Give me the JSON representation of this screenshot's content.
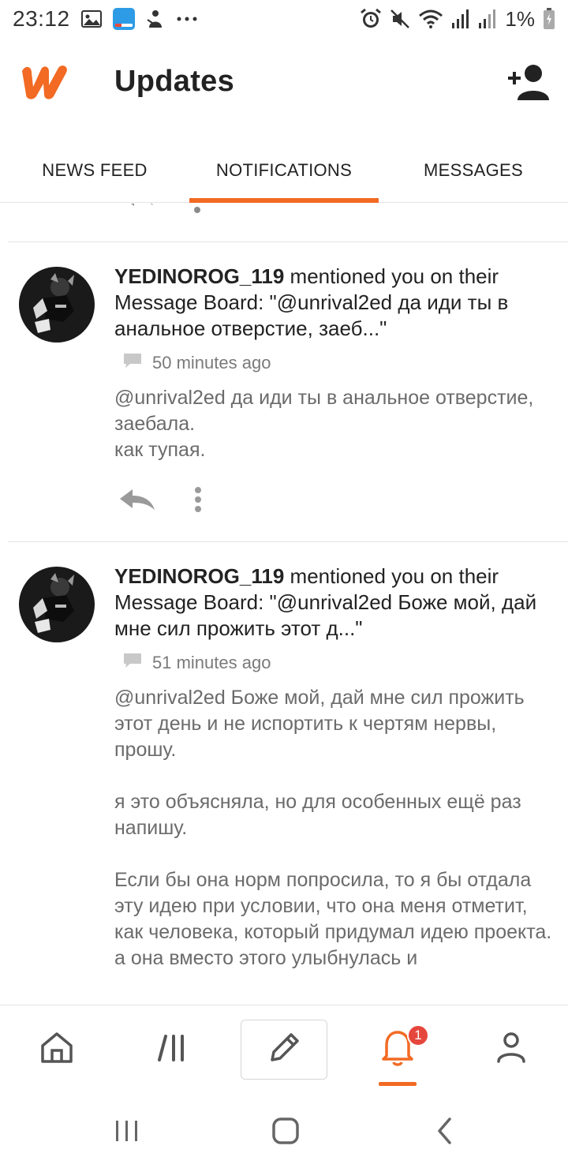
{
  "status_bar": {
    "time": "23:12",
    "battery_percent": "1%",
    "icons_left": [
      "image-icon",
      "wordbit-app-icon",
      "app-notification-icon",
      "more-dots-icon"
    ],
    "icons_right": [
      "alarm-icon",
      "mute-icon",
      "wifi-icon",
      "signal-icon",
      "signal-icon",
      "battery-charging-icon"
    ]
  },
  "header": {
    "title": "Updates",
    "logo_icon": "wattpad-logo",
    "add_friend_icon": "add-person-icon"
  },
  "tabs": [
    {
      "label": "NEWS FEED",
      "active": false
    },
    {
      "label": "NOTIFICATIONS",
      "active": true
    },
    {
      "label": "MESSAGES",
      "active": false
    }
  ],
  "notifications": [
    {
      "username": "YEDINOROG_119",
      "action_text": " mentioned you on their Message Board: \"@unrival2ed да иди ты в анальное отверстие, заеб...\"",
      "time": "50 minutes ago",
      "body": "@unrival2ed  да иди ты в анальное отверстие, заебала.\nкак тупая."
    },
    {
      "username": "YEDINOROG_119",
      "action_text": " mentioned you on their Message Board: \"@unrival2ed Боже мой, дай мне сил прожить этот д...\"",
      "time": "51 minutes ago",
      "body": "@unrival2ed  Боже мой, дай мне сил прожить этот день и не испортить к чертям нервы, прошу.\n\nя это объясняла, но для особенных ещё раз напишу.\n\nЕсли бы она норм попросила, то я бы отдала эту идею при условии, что она меня отметит, как человека, который придумал идею проекта.\nа она вместо этого улыбнулась и"
    }
  ],
  "bottom_nav": {
    "items": [
      "home-icon",
      "library-icon",
      "write-icon",
      "notifications-bell-icon",
      "profile-icon"
    ],
    "active": "notifications-bell-icon",
    "badge_count": "1"
  },
  "colors": {
    "accent": "#f26a23",
    "badge": "#e5473d",
    "text": "#222222",
    "muted": "#6b6b6b"
  }
}
